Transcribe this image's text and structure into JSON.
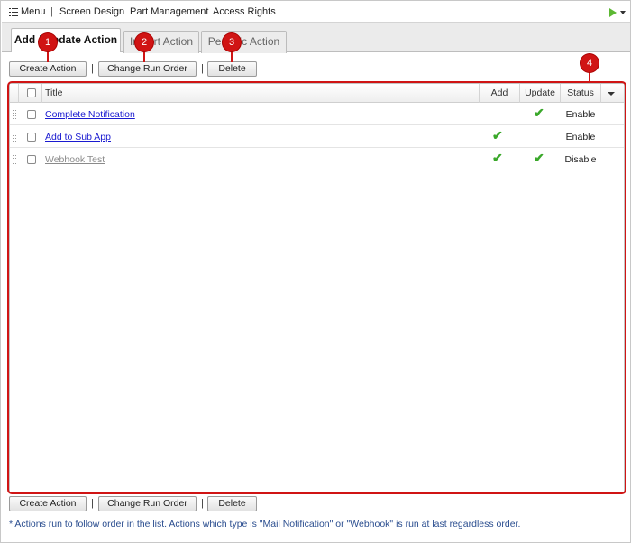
{
  "topbar": {
    "menu_label": "Menu",
    "separator": "|",
    "links": [
      "Screen Design",
      "Part Management",
      "Access Rights"
    ]
  },
  "tabs": [
    {
      "label": "Add / Update Action",
      "active": true
    },
    {
      "label": "Import Action",
      "active": false
    },
    {
      "label": "Periodic Action",
      "active": false
    }
  ],
  "toolbar": {
    "create_label": "Create Action",
    "run_order_label": "Change Run Order",
    "delete_label": "Delete",
    "separator": "|"
  },
  "grid": {
    "columns": [
      "Title",
      "Add",
      "Update",
      "Status"
    ],
    "rows": [
      {
        "title": "Complete Notification",
        "add": false,
        "update": true,
        "status": "Enable",
        "enabled": true
      },
      {
        "title": "Add to Sub App",
        "add": true,
        "update": false,
        "status": "Enable",
        "enabled": true
      },
      {
        "title": "Webhook Test",
        "add": true,
        "update": true,
        "status": "Disable",
        "enabled": false
      }
    ],
    "check_glyph": "✔"
  },
  "callouts": [
    "1",
    "2",
    "3",
    "4"
  ],
  "footnote": "* Actions run to follow order in the list. Actions which type is \"Mail Notification\" or \"Webhook\" is run at last regardless order.",
  "colors": {
    "callout": "#d01414",
    "check": "#3aa82a",
    "link": "#1a1ad0",
    "play": "#5cb833"
  }
}
